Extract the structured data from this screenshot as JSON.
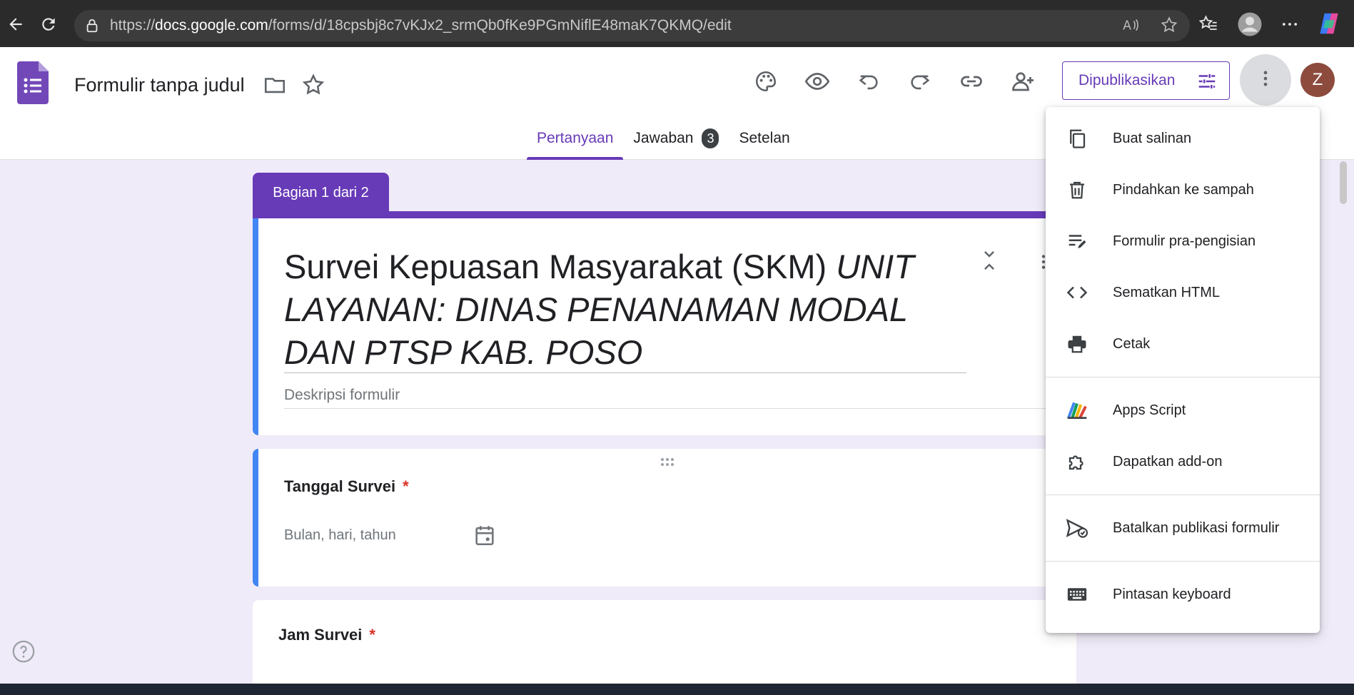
{
  "browser": {
    "url_prefix": "https://",
    "url_host": "docs.google.com",
    "url_path": "/forms/d/18cpsbj8c7vKJx2_srmQb0fKe9PGmNiflE48maK7QKMQ/edit"
  },
  "header": {
    "title": "Formulir tanpa judul",
    "publish_label": "Dipublikasikan",
    "avatar_letter": "Z"
  },
  "tabs": [
    {
      "label": "Pertanyaan",
      "active": true
    },
    {
      "label": "Jawaban",
      "badge": "3"
    },
    {
      "label": "Setelan"
    }
  ],
  "section_label": "Bagian 1 dari 2",
  "form": {
    "title_plain": "Survei Kepuasan Masyarakat (SKM) ",
    "title_italic": "UNIT LAYANAN: DINAS PENANAMAN MODAL DAN PTSP KAB. POSO",
    "description_placeholder": "Deskripsi formulir"
  },
  "questions": [
    {
      "label": "Tanggal Survei",
      "required_mark": "*",
      "placeholder": "Bulan, hari, tahun"
    },
    {
      "label": "Jam Survei",
      "required_mark": "*"
    }
  ],
  "menu": {
    "items": [
      {
        "label": "Buat salinan",
        "icon": "copy-icon"
      },
      {
        "label": "Pindahkan ke sampah",
        "icon": "trash-icon"
      },
      {
        "label": "Formulir pra-pengisian",
        "icon": "prefill-icon"
      },
      {
        "label": "Sematkan HTML",
        "icon": "code-icon"
      },
      {
        "label": "Cetak",
        "icon": "print-icon"
      },
      {
        "label": "Apps Script",
        "icon": "apps-script-icon"
      },
      {
        "label": "Dapatkan add-on",
        "icon": "addon-icon"
      },
      {
        "label": "Batalkan publikasi formulir",
        "icon": "unpublish-icon"
      },
      {
        "label": "Pintasan keyboard",
        "icon": "keyboard-icon"
      }
    ]
  },
  "colors": {
    "accent": "#673ab7",
    "background": "#f0ebf8",
    "active_card_border": "#4285f4",
    "required": "#d93025"
  }
}
